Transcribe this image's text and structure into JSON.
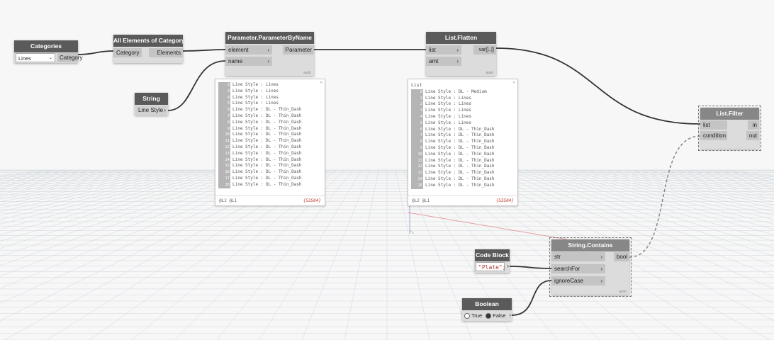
{
  "nodes": {
    "categories": {
      "title": "Categories",
      "dropdown_value": "Lines",
      "output": "Category"
    },
    "all_elements": {
      "title": "All Elements of Category",
      "input": "Category",
      "output": "Elements"
    },
    "param_by_name": {
      "title": "Parameter.ParameterByName",
      "inputs": [
        "element",
        "name"
      ],
      "output": "Parameter",
      "lacing": "auto"
    },
    "string": {
      "title": "String",
      "value": "Line Style"
    },
    "list_flatten": {
      "title": "List.Flatten",
      "inputs": [
        "list",
        "amt"
      ],
      "output": "var[]..[]",
      "lacing": "auto"
    },
    "list_filter": {
      "title": "List.Filter",
      "inputs": [
        "list",
        "condition"
      ],
      "outputs": [
        "in",
        "out"
      ]
    },
    "string_contains": {
      "title": "String.Contains",
      "inputs": [
        "str",
        "searchFor",
        "ignoreCase"
      ],
      "output": "bool",
      "lacing": "auto"
    },
    "code_block": {
      "title": "Code Block",
      "value": "\"Plate\";"
    },
    "boolean": {
      "title": "Boolean",
      "option_true": "True",
      "option_false": "False",
      "selected": "False"
    }
  },
  "preview_param": {
    "rows": [
      {
        "i": "2",
        "t": "Line Style : Lines"
      },
      {
        "i": "3",
        "t": "Line Style : Lines"
      },
      {
        "i": "4",
        "t": "Line Style : Lines"
      },
      {
        "i": "5",
        "t": "Line Style : Lines"
      },
      {
        "i": "6",
        "t": "Line Style : DL - Thin_Dash"
      },
      {
        "i": "7",
        "t": "Line Style : DL - Thin_Dash"
      },
      {
        "i": "8",
        "t": "Line Style : DL - Thin_Dash"
      },
      {
        "i": "9",
        "t": "Line Style : DL - Thin_Dash"
      },
      {
        "i": "10",
        "t": "Line Style : DL - Thin_Dash"
      },
      {
        "i": "11",
        "t": "Line Style : DL - Thin_Dash"
      },
      {
        "i": "12",
        "t": "Line Style : DL - Thin_Dash"
      },
      {
        "i": "13",
        "t": "Line Style : DL - Thin_Dash"
      },
      {
        "i": "14",
        "t": "Line Style : DL - Thin_Dash"
      },
      {
        "i": "15",
        "t": "Line Style : DL - Thin_Dash"
      },
      {
        "i": "16",
        "t": "Line Style : DL - Thin_Dash"
      },
      {
        "i": "17",
        "t": "Line Style : DL - Thin_Dash"
      },
      {
        "i": "18",
        "t": "Line Style : DL - Thin_Dash"
      }
    ],
    "levels": "@L2 @L1",
    "count": "{53504}"
  },
  "preview_flatten": {
    "header": "List",
    "rows": [
      {
        "i": "0",
        "t": "Line Style : DL - Medium"
      },
      {
        "i": "1",
        "t": "Line Style : Lines"
      },
      {
        "i": "2",
        "t": "Line Style : Lines"
      },
      {
        "i": "3",
        "t": "Line Style : Lines"
      },
      {
        "i": "4",
        "t": "Line Style : Lines"
      },
      {
        "i": "5",
        "t": "Line Style : Lines"
      },
      {
        "i": "6",
        "t": "Line Style : DL - Thin_Dash"
      },
      {
        "i": "7",
        "t": "Line Style : DL - Thin_Dash"
      },
      {
        "i": "8",
        "t": "Line Style : DL - Thin_Dash"
      },
      {
        "i": "9",
        "t": "Line Style : DL - Thin_Dash"
      },
      {
        "i": "10",
        "t": "Line Style : DL - Thin_Dash"
      },
      {
        "i": "11",
        "t": "Line Style : DL - Thin_Dash"
      },
      {
        "i": "12",
        "t": "Line Style : DL - Thin_Dash"
      },
      {
        "i": "13",
        "t": "Line Style : DL - Thin_Dash"
      },
      {
        "i": "14",
        "t": "Line Style : DL - Thin_Dash"
      },
      {
        "i": "15",
        "t": "Line Style : DL - Thin_Dash"
      }
    ],
    "levels": "@L2 @L1",
    "count": "{53504}"
  },
  "icons": {
    "port_arrow": "chevron-right-icon",
    "dropdown_arrow": "chevron-down-icon",
    "close": "close-icon"
  },
  "colors": {
    "node_header": "#5a5a5a",
    "node_body": "#dcdcdc",
    "port": "#c4c4c4",
    "wire": "#333333",
    "count_text": "#c0392b",
    "code_text": "#b03a2e"
  }
}
